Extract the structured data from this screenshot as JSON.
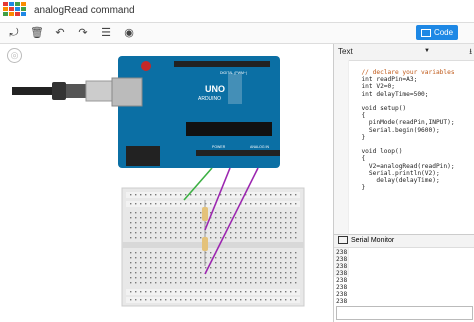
{
  "app": {
    "logo_letters": [
      "TIN",
      "KER",
      "CAD"
    ],
    "title": "analogRead command"
  },
  "toolbar": {
    "icons": [
      "rotate-icon",
      "delete-icon",
      "undo-icon",
      "redo-icon",
      "notes-icon",
      "view-icon"
    ],
    "code_button_label": "Code"
  },
  "board": {
    "brand_label": "ARDUINO",
    "model_label": "UNO",
    "digital_label": "DIGITAL (PWM~)",
    "power_label": "POWER",
    "analog_label": "ANALOG IN"
  },
  "editor": {
    "mode_select": "Text",
    "code_lines": [
      {
        "cls": "c",
        "text": "  // declare your variables"
      },
      {
        "cls": "",
        "text": "  int readPin=A3;"
      },
      {
        "cls": "",
        "text": "  int V2=0;"
      },
      {
        "cls": "",
        "text": "  int delayTime=500;"
      },
      {
        "cls": "",
        "text": ""
      },
      {
        "cls": "",
        "text": "  void setup()"
      },
      {
        "cls": "",
        "text": "  {"
      },
      {
        "cls": "",
        "text": "    pinMode(readPin,INPUT);"
      },
      {
        "cls": "",
        "text": "    Serial.begin(9600);"
      },
      {
        "cls": "",
        "text": "  }"
      },
      {
        "cls": "",
        "text": ""
      },
      {
        "cls": "",
        "text": "  void loop()"
      },
      {
        "cls": "",
        "text": "  {"
      },
      {
        "cls": "",
        "text": "    V2=analogRead(readPin);"
      },
      {
        "cls": "",
        "text": "    Serial.println(V2);"
      },
      {
        "cls": "",
        "text": "      delay(delayTime);"
      },
      {
        "cls": "",
        "text": "  }"
      }
    ]
  },
  "serial_monitor": {
    "title": "Serial Monitor",
    "output": [
      "238",
      "238",
      "238",
      "238",
      "238",
      "238",
      "238",
      "238"
    ]
  }
}
